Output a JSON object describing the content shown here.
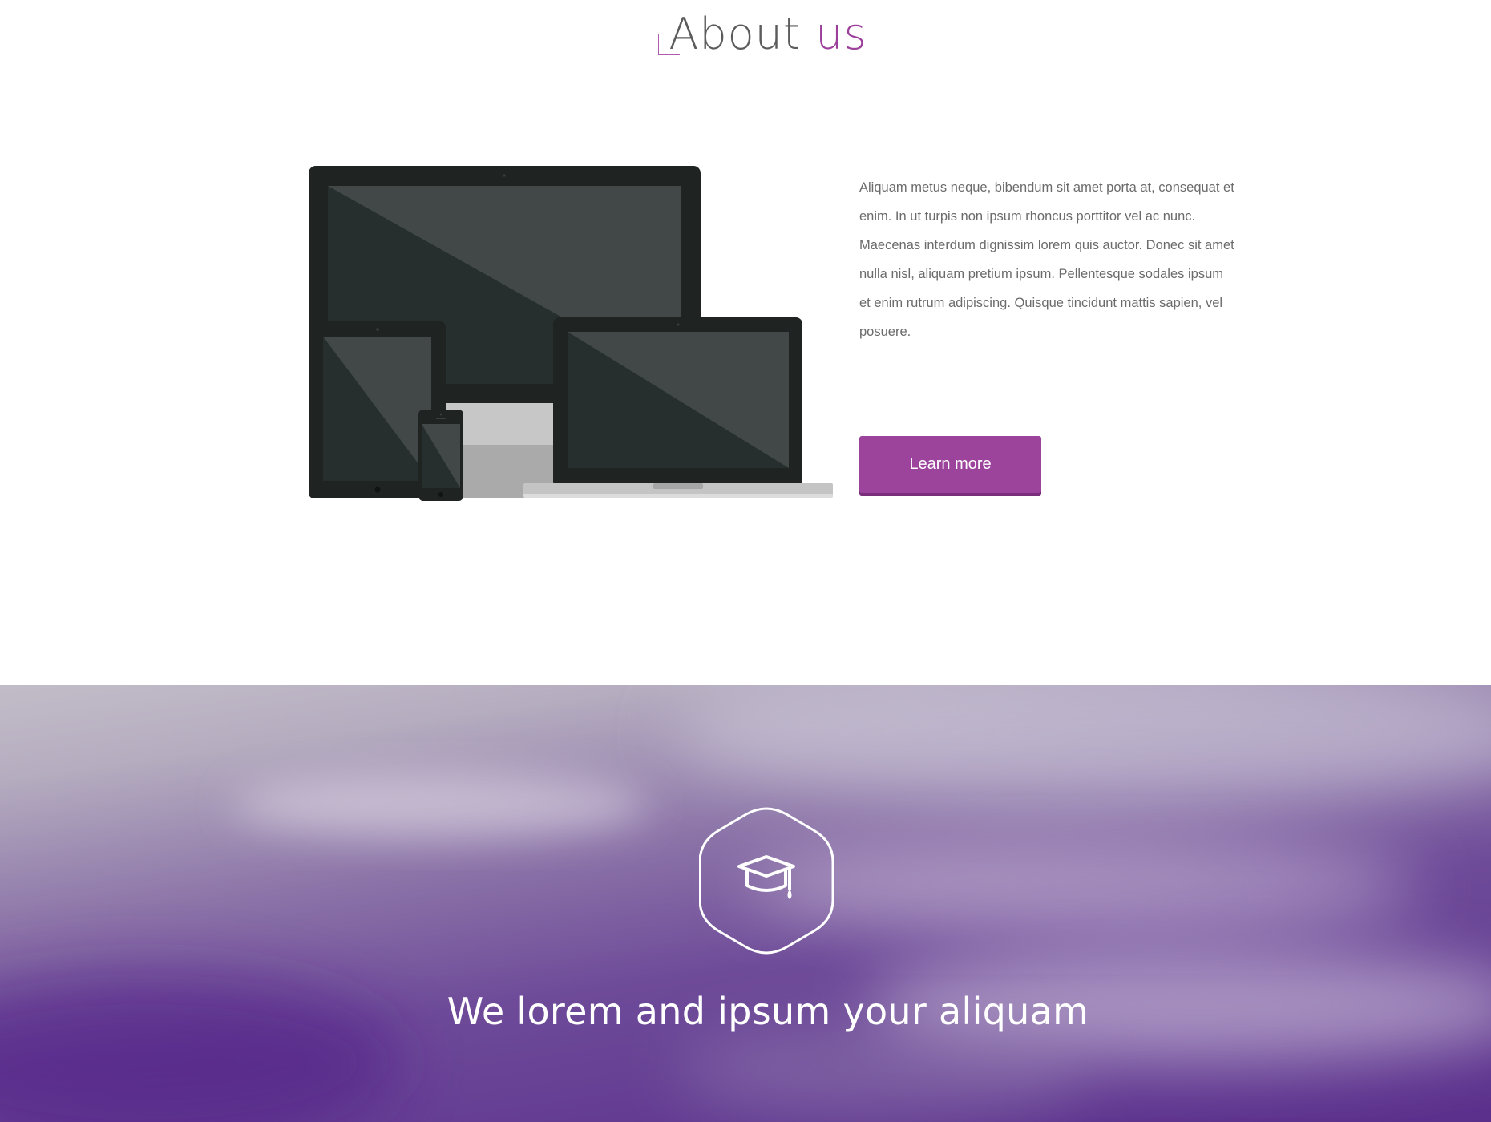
{
  "about": {
    "title_prefix": "About",
    "title_accent": "us",
    "body": "Aliquam metus neque, bibendum sit amet porta at, consequat et enim. In ut turpis non ipsum rhoncus porttitor vel ac nunc. Maecenas interdum dignissim lorem quis auctor. Donec sit amet nulla nisl, aliquam pretium ipsum. Pellentesque sodales ipsum et enim rutrum adipiscing. Quisque tincidunt mattis sapien, vel posuere.",
    "button_label": "Learn more",
    "illustration": "responsive-devices-illustration"
  },
  "hero": {
    "icon": "graduation-cap-icon",
    "heading": "We lorem and ipsum your aliquam"
  },
  "colors": {
    "accent": "#9c449c",
    "button_shadow": "#7a2f7d",
    "text": "#6b6b6b",
    "title": "#5c5c5c",
    "hero_purple": "#5a2f8c"
  }
}
